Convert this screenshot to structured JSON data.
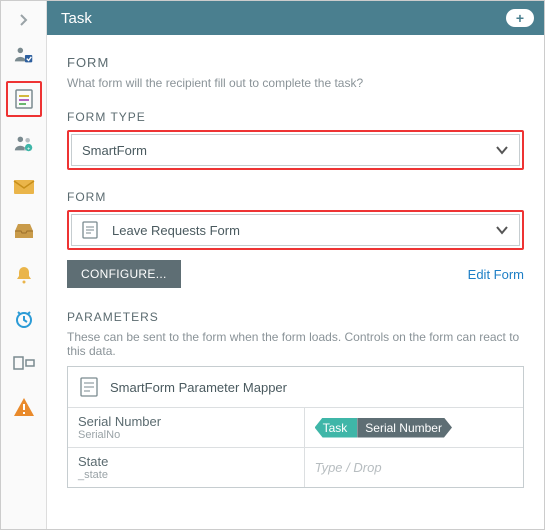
{
  "header": {
    "title": "Task"
  },
  "form": {
    "title": "FORM",
    "subtext": "What form will the recipient fill out to complete the task?",
    "type_label": "FORM TYPE",
    "type_value": "SmartForm",
    "form_label": "FORM",
    "form_value": "Leave Requests Form",
    "configure_btn": "CONFIGURE...",
    "edit_link": "Edit Form"
  },
  "parameters": {
    "title": "PARAMETERS",
    "subtext": "These can be sent to the form when the form loads. Controls on the form can react to this data.",
    "mapper_title": "SmartForm Parameter Mapper",
    "rows": [
      {
        "name": "Serial Number",
        "sub": "SerialNo",
        "pill_left": "Task",
        "pill_right": "Serial Number"
      },
      {
        "name": "State",
        "sub": "_state",
        "placeholder": "Type / Drop"
      }
    ]
  },
  "sidebar": {
    "items": [
      "expand-icon",
      "users-check-icon",
      "form-icon",
      "people-icon",
      "mail-icon",
      "inbox-icon",
      "bell-icon",
      "clock-icon",
      "layout-icon",
      "warning-icon"
    ]
  }
}
